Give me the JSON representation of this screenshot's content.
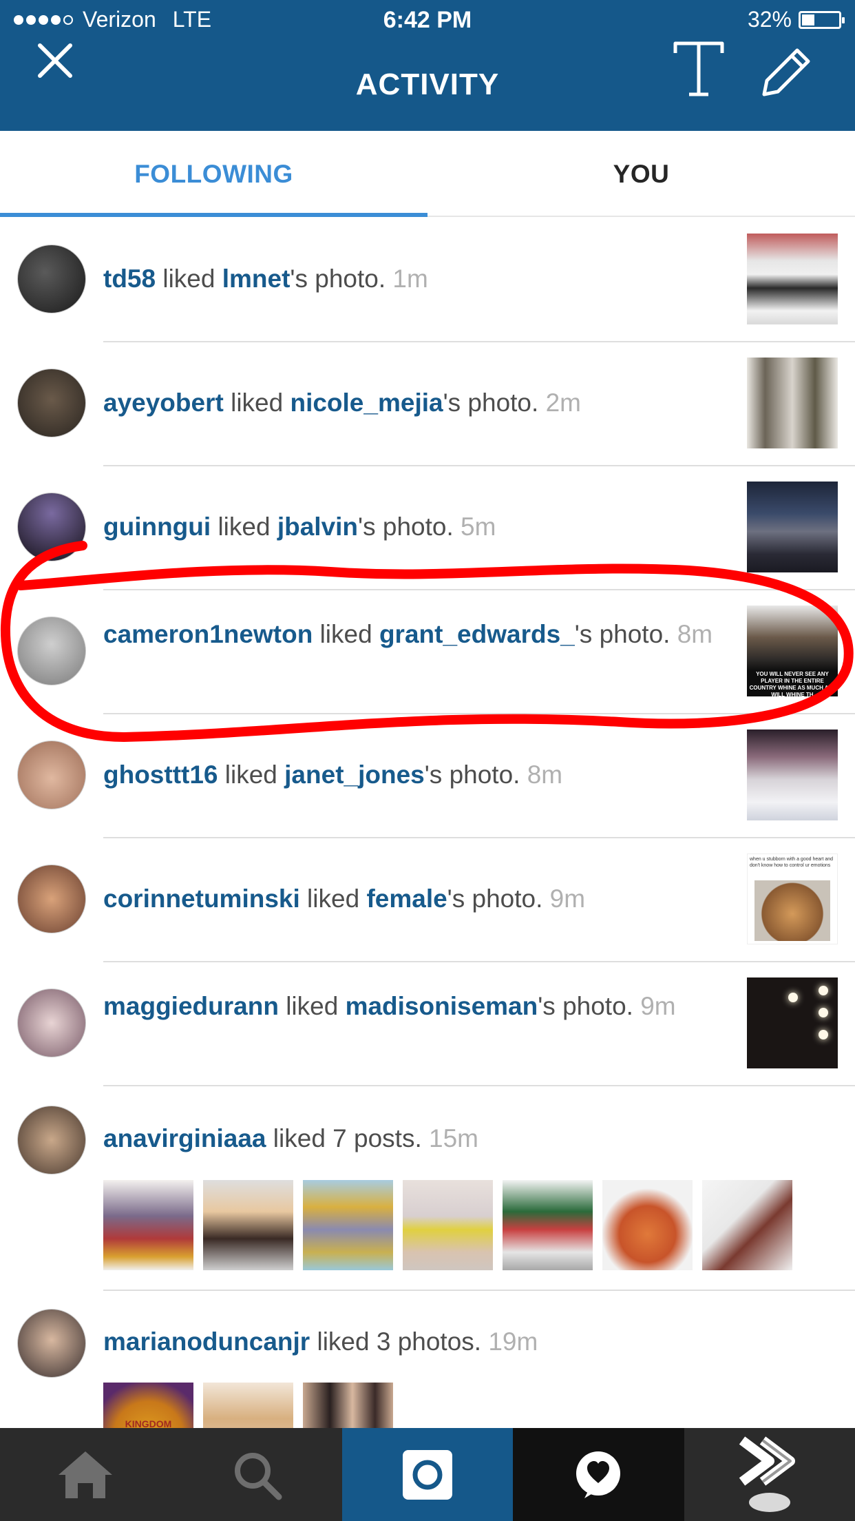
{
  "status_bar": {
    "carrier": "Verizon",
    "network": "LTE",
    "time": "6:42 PM",
    "battery": "32%",
    "battery_level": 0.32
  },
  "header": {
    "title": "ACTIVITY",
    "close_icon": "close-icon",
    "text_icon": "text-T-icon",
    "edit_icon": "pencil-icon"
  },
  "tabs": [
    {
      "label": "FOLLOWING",
      "active": true
    },
    {
      "label": "YOU",
      "active": false
    }
  ],
  "feed": [
    {
      "user": "td58",
      "action": " liked ",
      "target": "lmnet",
      "suffix": "'s photo. ",
      "time": "1m"
    },
    {
      "user": "ayeyobert",
      "action": " liked ",
      "target": "nicole_mejia",
      "suffix": "'s photo. ",
      "time": "2m"
    },
    {
      "user": "guinngui",
      "action": " liked ",
      "target": "jbalvin",
      "suffix": "'s photo. ",
      "time": "5m"
    },
    {
      "user": "cameron1newton",
      "action": " liked ",
      "target": "grant_edwards_",
      "suffix": "'s photo. ",
      "time": "8m",
      "thumb_caption": "YOU WILL NEVER SEE ANY PLAYER IN THE ENTIRE COUNTRY WHINE AS MUCH AS I WILL WHINE TH"
    },
    {
      "user": "ghosttt16",
      "action": " liked ",
      "target": "janet_jones",
      "suffix": "'s photo. ",
      "time": "8m"
    },
    {
      "user": "corinnetuminski",
      "action": " liked ",
      "target": "female",
      "suffix": "'s photo. ",
      "time": "9m",
      "thumb_caption": "when u stubborn with a good heart and don't know how to control ur emotions"
    },
    {
      "user": "maggiedurann",
      "action": " liked ",
      "target": "madisoniseman",
      "suffix": "'s photo. ",
      "time": "9m"
    },
    {
      "user": "anavirginiaaa",
      "action": " liked 7 posts. ",
      "time": "15m",
      "thumb_count": 7
    },
    {
      "user": "marianoduncanjr",
      "action": " liked 3 photos. ",
      "time": "19m",
      "thumb_count": 3,
      "thumb_caption": "KINGDOM"
    }
  ],
  "bottom_nav": [
    {
      "name": "home-icon"
    },
    {
      "name": "search-icon"
    },
    {
      "name": "camera-icon",
      "active": true
    },
    {
      "name": "activity-heart-icon"
    },
    {
      "name": "profile-icon"
    }
  ],
  "colors": {
    "header": "#15588a",
    "username": "#175a8c",
    "active_tab": "#3b8dd6",
    "annotation": "#ff0000"
  }
}
